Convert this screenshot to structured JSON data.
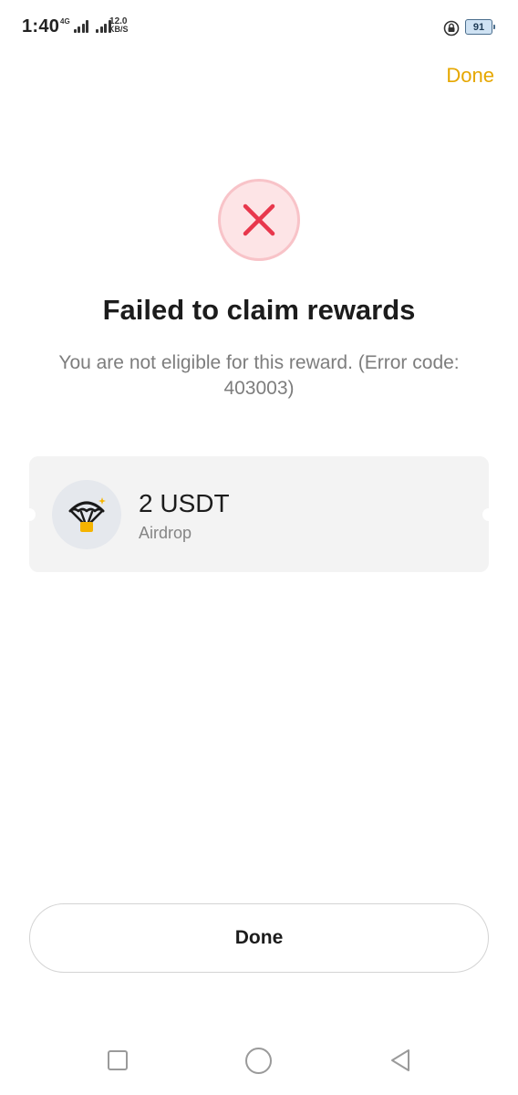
{
  "status_bar": {
    "time": "1:40",
    "network_type": "4G",
    "speed_value": "12.0",
    "speed_unit": "KB/S",
    "battery_level": "91",
    "icons": [
      "signal-icon",
      "signal-icon",
      "rotation-lock-icon",
      "battery-icon"
    ]
  },
  "header": {
    "done_label": "Done"
  },
  "result": {
    "icon": "close-icon",
    "title": "Failed to claim rewards",
    "message": "You are not eligible for this reward. (Error code: 403003)"
  },
  "reward": {
    "icon": "parachute-icon",
    "amount": "2 USDT",
    "type": "Airdrop"
  },
  "footer": {
    "done_label": "Done"
  },
  "nav": {
    "icons": [
      "recent-apps-icon",
      "home-icon",
      "back-icon"
    ]
  },
  "colors": {
    "accent": "#e6a700",
    "error": "#e8374c",
    "error_bg": "#fde4e6",
    "card_bg": "#f3f3f3"
  }
}
